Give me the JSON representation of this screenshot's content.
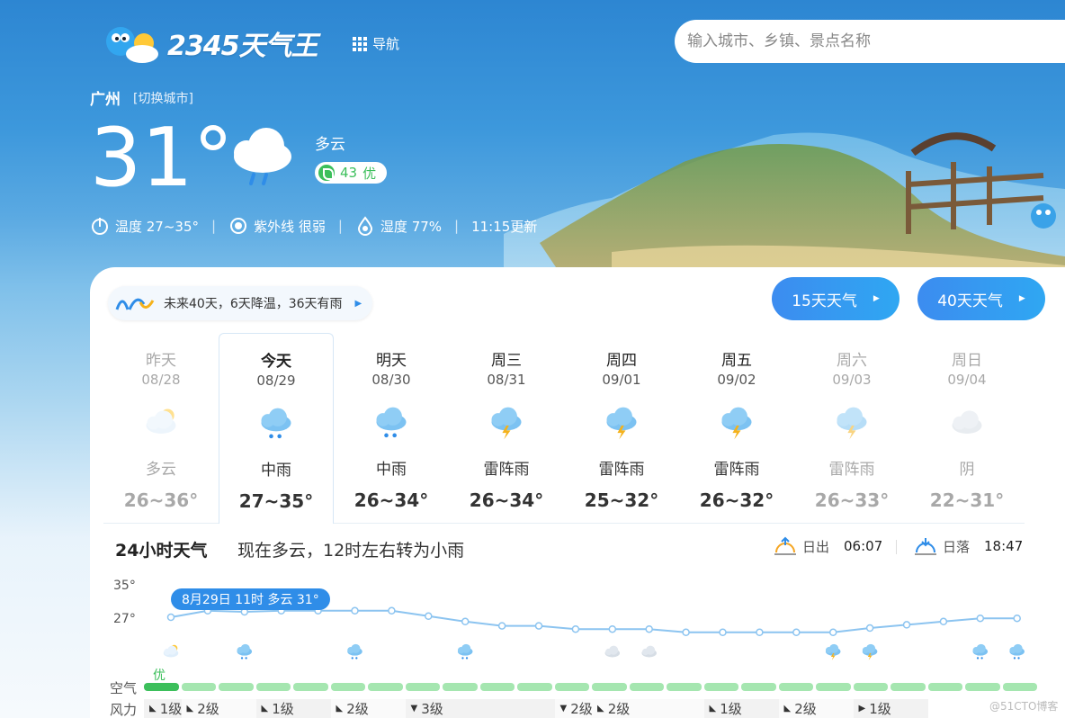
{
  "header": {
    "logo_text": "2345天气王",
    "nav_label": "导航",
    "search_placeholder": "输入城市、乡镇、景点名称"
  },
  "location": {
    "city": "广州",
    "switch_label": "[切换城市]"
  },
  "current": {
    "temperature": "31°",
    "condition": "多云",
    "aqi_value": "43",
    "aqi_level": "优",
    "temp_range": "温度 27~35°",
    "uv": "紫外线 很弱",
    "humidity": "湿度 77%",
    "updated": "11:15更新",
    "sep": "|"
  },
  "forecast_hint": "未来40天，6天降温，36天有雨",
  "buttons": {
    "days15": "15天天气",
    "days40": "40天天气"
  },
  "daily": [
    {
      "name": "昨天",
      "date": "08/28",
      "desc": "多云",
      "range": "26~36°",
      "icon": "partly-cloudy-sun-icon",
      "muted": true
    },
    {
      "name": "今天",
      "date": "08/29",
      "desc": "中雨",
      "range": "27~35°",
      "icon": "rain-icon",
      "today": true
    },
    {
      "name": "明天",
      "date": "08/30",
      "desc": "中雨",
      "range": "26~34°",
      "icon": "rain-icon"
    },
    {
      "name": "周三",
      "date": "08/31",
      "desc": "雷阵雨",
      "range": "26~34°",
      "icon": "thunderstorm-icon"
    },
    {
      "name": "周四",
      "date": "09/01",
      "desc": "雷阵雨",
      "range": "25~32°",
      "icon": "thunderstorm-icon"
    },
    {
      "name": "周五",
      "date": "09/02",
      "desc": "雷阵雨",
      "range": "26~32°",
      "icon": "thunderstorm-icon"
    },
    {
      "name": "周六",
      "date": "09/03",
      "desc": "雷阵雨",
      "range": "26~33°",
      "icon": "thunderstorm-icon",
      "muted": true
    },
    {
      "name": "周日",
      "date": "09/04",
      "desc": "阴",
      "range": "22~31°",
      "icon": "overcast-icon",
      "muted": true
    }
  ],
  "hourly": {
    "title": "24小时天气",
    "summary": "现在多云，12时左右转为小雨",
    "sunrise_label": "日出",
    "sunrise": "06:07",
    "sunset_label": "日落",
    "sunset": "18:47",
    "y_top": "35°",
    "y_mid": "27°",
    "tooltip": "8月29日 11时 多云 31°",
    "air_label": "空气",
    "air_first": "优",
    "wind_label": "风力",
    "watermark": "@51CTO博客"
  },
  "hourly_series": {
    "temps": [
      31,
      31.6,
      31.5,
      31.6,
      31.6,
      31.6,
      31.6,
      31.1,
      30.6,
      30.2,
      30.2,
      29.9,
      29.9,
      29.9,
      29.6,
      29.6,
      29.6,
      29.6,
      29.6,
      30,
      30.3,
      30.6,
      30.9,
      30.9
    ],
    "icons": [
      "partly-cloudy-sun-icon",
      "",
      "rain-icon",
      "",
      "",
      "rain-icon",
      "",
      "",
      "rain-icon",
      "",
      "",
      "",
      "overcast-icon",
      "overcast-icon",
      "",
      "",
      "",
      "",
      "thunderstorm-icon",
      "thunderstorm-icon",
      "",
      "",
      "rain-icon",
      "rain-icon"
    ],
    "wind_segments": [
      {
        "label": "1级",
        "dir": "◣",
        "hours": 1,
        "shade": "shade"
      },
      {
        "label": "2级",
        "dir": "◣",
        "hours": 2,
        "shade": "light"
      },
      {
        "label": "1级",
        "dir": "◣",
        "hours": 2,
        "shade": "shade"
      },
      {
        "label": "2级",
        "dir": "◣",
        "hours": 2,
        "shade": "light"
      },
      {
        "label": "3级",
        "dir": "▼",
        "hours": 4,
        "shade": "shade"
      },
      {
        "label": "2级",
        "dir": "▼",
        "hours": 1,
        "shade": "light"
      },
      {
        "label": "2级",
        "dir": "◣",
        "hours": 3,
        "shade": "light"
      },
      {
        "label": "1级",
        "dir": "◣",
        "hours": 2,
        "shade": "shade"
      },
      {
        "label": "2级",
        "dir": "◣",
        "hours": 2,
        "shade": "light"
      },
      {
        "label": "1级",
        "dir": "▶",
        "hours": 2,
        "shade": "shade"
      }
    ]
  },
  "colors": {
    "accent": "#2f8de8",
    "good_air": "#3cbf5b",
    "air_bar": "#a5e6b0"
  }
}
